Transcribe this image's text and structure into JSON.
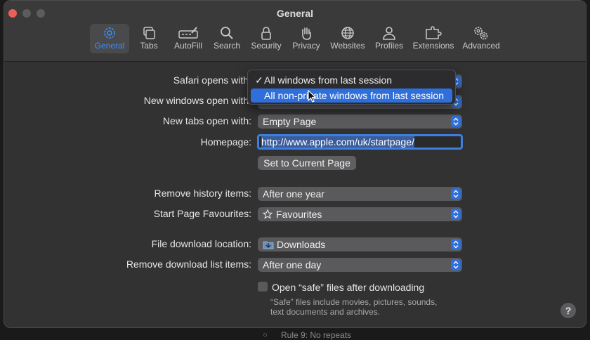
{
  "window": {
    "title": "General"
  },
  "toolbar": {
    "tabs": [
      {
        "label": "General",
        "icon": "gear-icon",
        "active": true
      },
      {
        "label": "Tabs",
        "icon": "tabs-icon"
      },
      {
        "label": "AutoFill",
        "icon": "autofill-icon"
      },
      {
        "label": "Search",
        "icon": "search-icon"
      },
      {
        "label": "Security",
        "icon": "lock-icon"
      },
      {
        "label": "Privacy",
        "icon": "hand-icon"
      },
      {
        "label": "Websites",
        "icon": "globe-icon"
      },
      {
        "label": "Profiles",
        "icon": "person-icon"
      },
      {
        "label": "Extensions",
        "icon": "puzzle-icon"
      },
      {
        "label": "Advanced",
        "icon": "gears-icon"
      }
    ]
  },
  "settings": {
    "safari_opens_label": "Safari opens with:",
    "new_windows_label": "New windows open with:",
    "new_tabs_label": "New tabs open with:",
    "new_tabs_value": "Empty Page",
    "homepage_label": "Homepage:",
    "homepage_value": "http://www.apple.com/uk/startpage/",
    "set_current_page": "Set to Current Page",
    "remove_history_label": "Remove history items:",
    "remove_history_value": "After one year",
    "start_page_label": "Start Page Favourites:",
    "start_page_value": "Favourites",
    "download_location_label": "File download location:",
    "download_location_value": "Downloads",
    "remove_download_label": "Remove download list items:",
    "remove_download_value": "After one day",
    "open_safe_label": "Open “safe” files after downloading",
    "open_safe_checked": false,
    "open_safe_note": "“Safe” files include movies, pictures, sounds, text documents and archives."
  },
  "dropdown_menu": {
    "items": [
      {
        "label": "All windows from last session",
        "checked": true
      },
      {
        "label": "All non-private windows from last session",
        "highlighted": true
      }
    ],
    "check_glyph": "✓"
  },
  "help": {
    "label": "?"
  },
  "background": {
    "text": "Rule 9: No repeats"
  },
  "colors": {
    "accent": "#3d8ef6",
    "highlight": "#2f6fdc"
  }
}
